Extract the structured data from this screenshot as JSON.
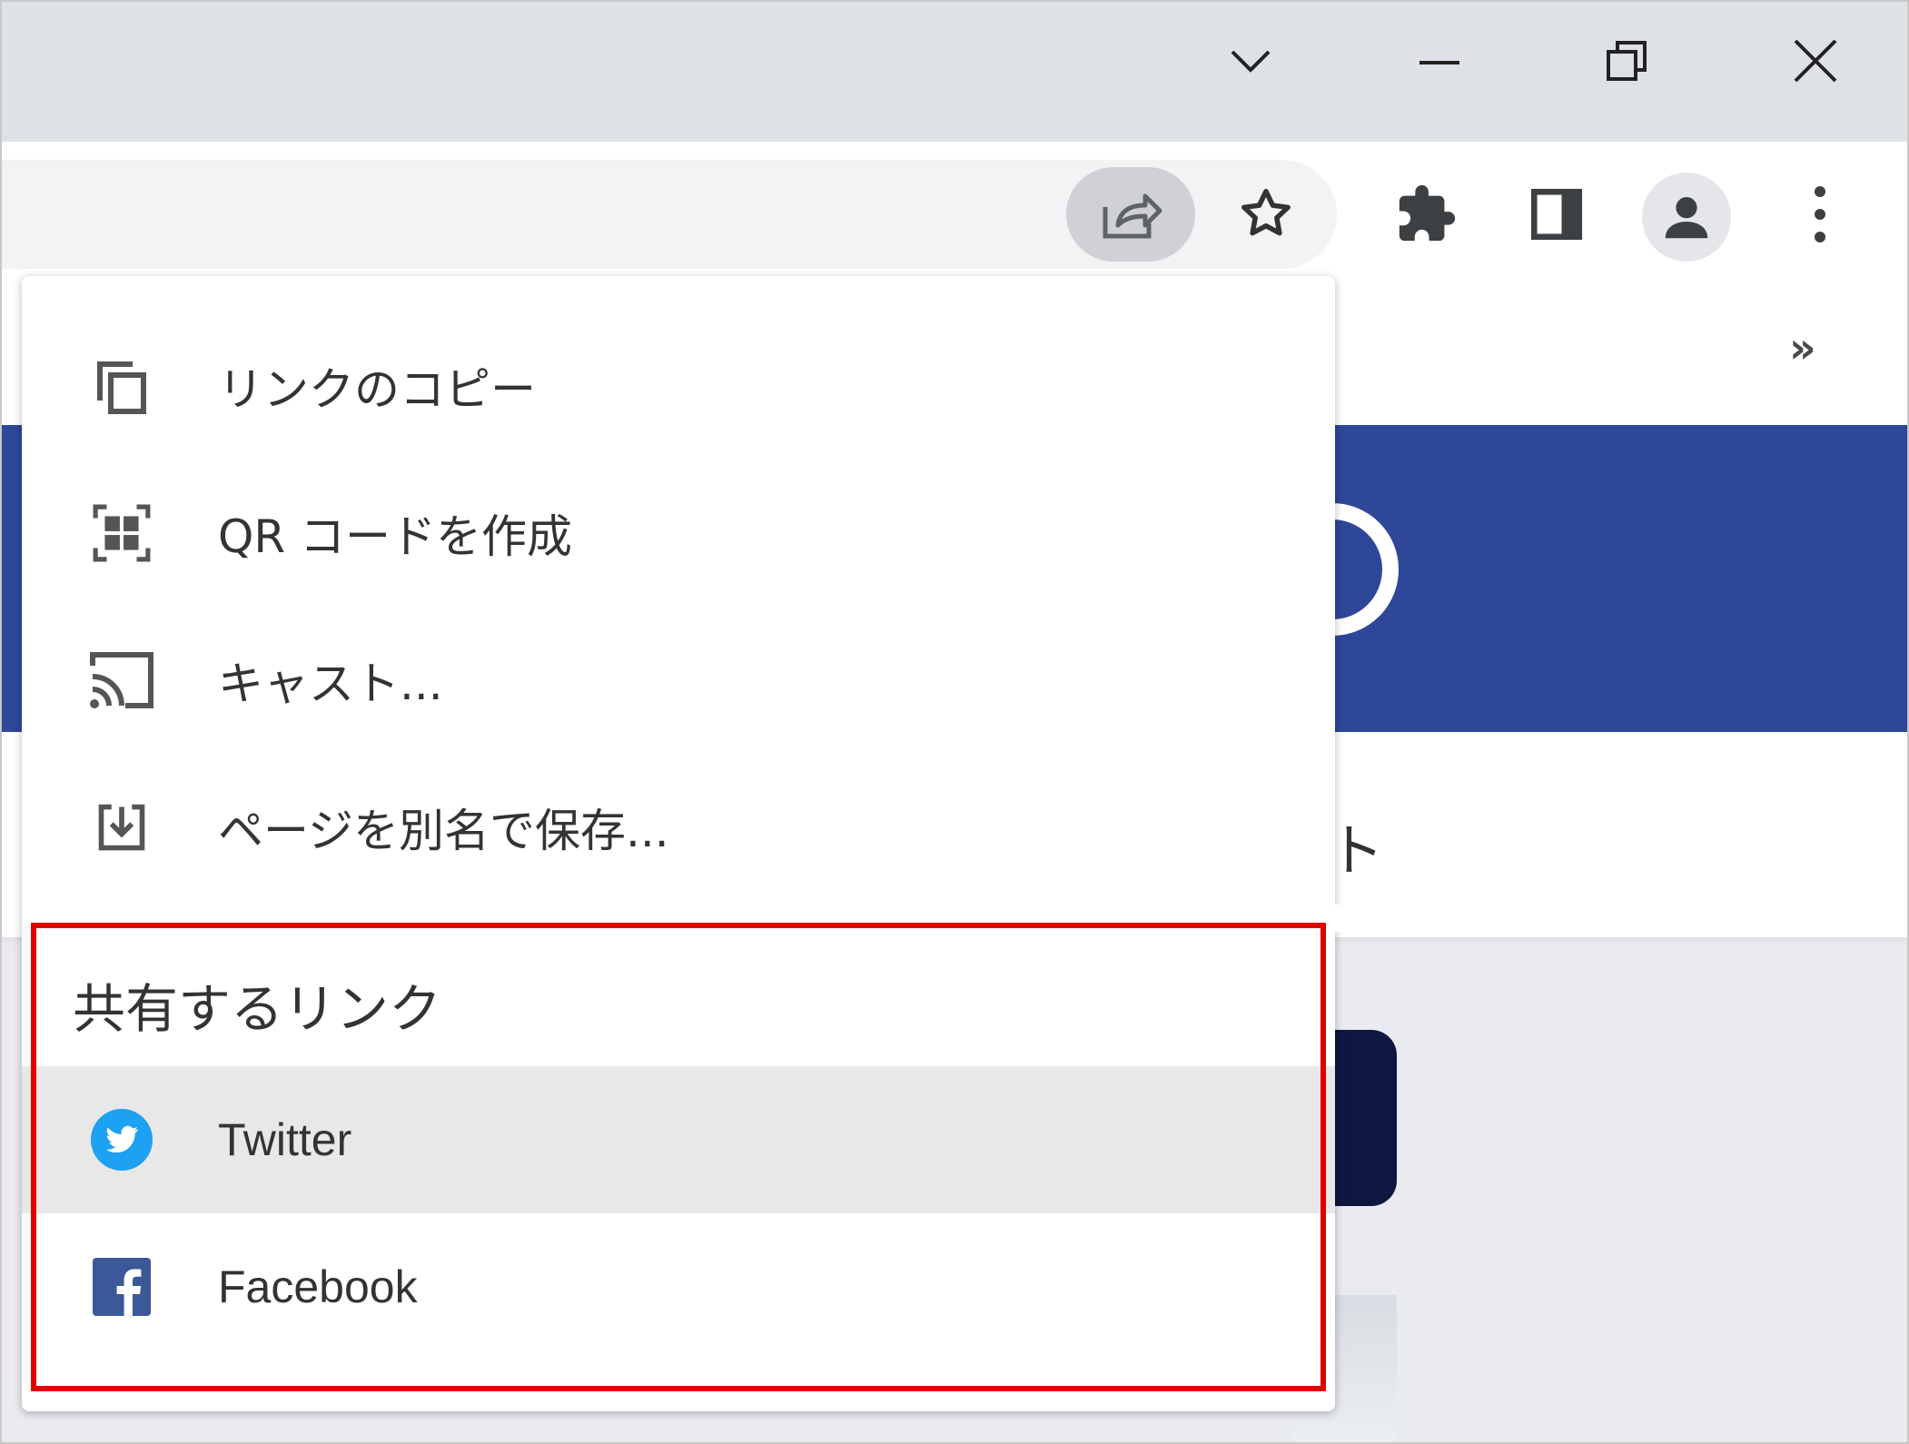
{
  "window": {
    "controls": [
      "tab-search",
      "minimize",
      "restore",
      "close"
    ]
  },
  "toolbar": {
    "share_icon": "share-icon",
    "star_icon": "star-icon",
    "extensions_icon": "puzzle-icon",
    "side_panel_icon": "side-panel-icon",
    "profile_icon": "avatar-icon",
    "menu_icon": "kebab-menu-icon"
  },
  "bookmarks": {
    "overflow": "»"
  },
  "page": {
    "fragment_text": "ト"
  },
  "share_menu": {
    "items": [
      {
        "label": "リンクのコピー",
        "icon": "copy-icon"
      },
      {
        "label": "QR コードを作成",
        "icon": "qr-code-icon"
      },
      {
        "label": "キャスト...",
        "icon": "cast-icon"
      },
      {
        "label": "ページを別名で保存...",
        "icon": "save-page-icon"
      }
    ],
    "section_title": "共有するリンク",
    "links": [
      {
        "label": "Twitter",
        "icon": "twitter-icon",
        "color": "#1da1f2"
      },
      {
        "label": "Facebook",
        "icon": "facebook-icon",
        "color": "#3b5998"
      }
    ]
  },
  "colors": {
    "highlight": "#e00000",
    "banner": "#2e4799"
  }
}
